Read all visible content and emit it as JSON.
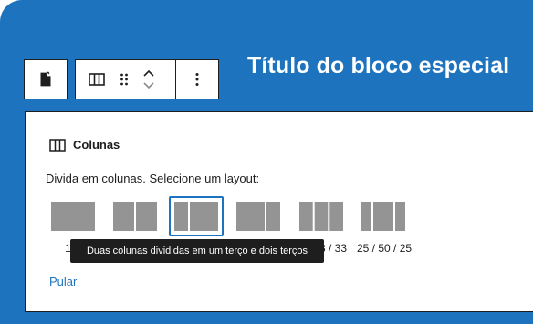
{
  "page": {
    "title": "Título do bloco especial"
  },
  "toolbar": {
    "items": [
      {
        "icon": "block-icon"
      },
      {
        "icon": "columns-icon"
      },
      {
        "icon": "drag-handle-icon"
      },
      {
        "icon": "move-up-icon"
      },
      {
        "icon": "move-down-icon"
      },
      {
        "icon": "more-options-icon"
      }
    ]
  },
  "placeholder": {
    "block_name": "Colunas",
    "instructions": "Divida em colunas. Selecione um layout:",
    "variations": [
      {
        "label": "100",
        "visible_label": "1",
        "shape": [
          1
        ]
      },
      {
        "label": "50 / 50",
        "visible_label": "",
        "shape": [
          1,
          1
        ]
      },
      {
        "label": "33 / 66",
        "visible_label": "",
        "shape": [
          1,
          2
        ],
        "selected": true
      },
      {
        "label": "66 / 33",
        "visible_label": "",
        "shape": [
          2,
          1
        ]
      },
      {
        "label": "33 / 33 / 33",
        "visible_label": "3 / 33",
        "shape": [
          1,
          1,
          1
        ]
      },
      {
        "label": "25 / 50 / 25",
        "visible_label": "25 / 50 / 25",
        "shape": [
          1,
          2,
          1
        ]
      }
    ],
    "tooltip": "Duas colunas divididas em um terço e dois terços",
    "skip_label": "Pular"
  },
  "colors": {
    "accent": "#1e73be",
    "dark": "#1e1e1e",
    "variation_fill": "#949494"
  }
}
